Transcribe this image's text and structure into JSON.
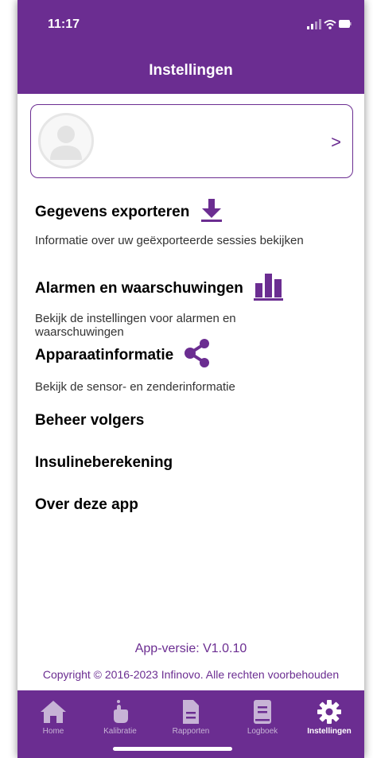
{
  "status": {
    "time": "11:17"
  },
  "header": {
    "title": "Instellingen"
  },
  "profile": {
    "chevron": ">"
  },
  "sections": [
    {
      "title": "Gegevens exporteren",
      "subtitle": "Informatie over uw geëxporteerde sessies bekijken",
      "icon": "download-icon"
    },
    {
      "title": "Alarmen en waarschuwingen",
      "subtitle": "Bekijk de instellingen voor alarmen en waarschuwingen",
      "icon": "bar-chart-icon"
    },
    {
      "title": "Apparaatinformatie",
      "subtitle": "Bekijk de sensor- en zenderinformatie",
      "icon": "share-icon"
    },
    {
      "title": "Beheer volgers"
    },
    {
      "title": "Insulineberekening"
    },
    {
      "title": "Over deze app"
    }
  ],
  "footer": {
    "version": "App-versie: V1.0.10",
    "copyright": "Copyright © 2016-2023 Infinovo. Alle rechten voorbehouden"
  },
  "tabs": [
    {
      "label": "Home",
      "icon": "home-icon"
    },
    {
      "label": "Kalibratie",
      "icon": "finger-icon"
    },
    {
      "label": "Rapporten",
      "icon": "document-icon"
    },
    {
      "label": "Logboek",
      "icon": "book-icon"
    },
    {
      "label": "Instellingen",
      "icon": "gear-icon",
      "active": true
    }
  ],
  "colors": {
    "brand": "#6b2d91",
    "tab_inactive": "#c7b3d6"
  }
}
